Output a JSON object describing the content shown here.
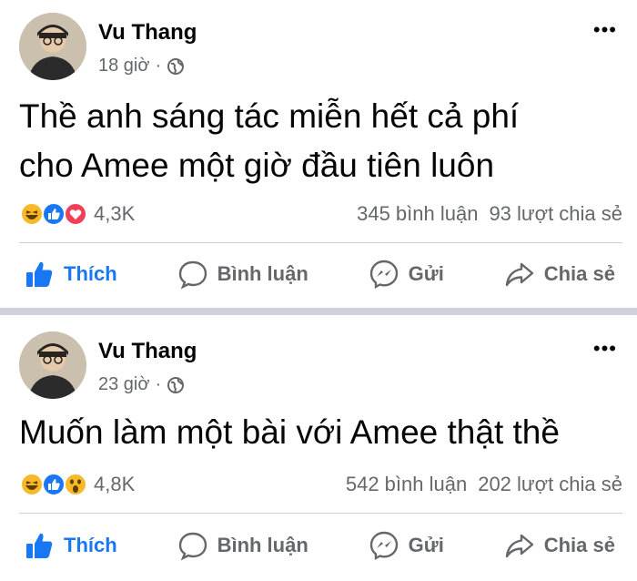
{
  "posts": [
    {
      "author": "Vu Thang",
      "time": "18 giờ",
      "separator": "·",
      "more": "•••",
      "text_line1": "Thề anh sáng tác miễn hết cả phí",
      "text_line2": "cho Amee một giờ đầu tiên luôn",
      "reactions": [
        "haha-icon",
        "like-icon",
        "love-icon"
      ],
      "reaction_count": "4,3K",
      "comments": "345 bình luận",
      "shares": "93 lượt chia sẻ",
      "actions": {
        "like": "Thích",
        "comment": "Bình luận",
        "send": "Gửi",
        "share": "Chia sẻ"
      }
    },
    {
      "author": "Vu Thang",
      "time": "23 giờ",
      "separator": "·",
      "more": "•••",
      "text_line1": "Muốn làm một bài với Amee thật thề",
      "reactions": [
        "haha-icon",
        "like-icon",
        "wow-icon"
      ],
      "reaction_count": "4,8K",
      "comments": "542 bình luận",
      "shares": "202 lượt chia sẻ",
      "actions": {
        "like": "Thích",
        "comment": "Bình luận",
        "send": "Gửi",
        "share": "Chia sẻ"
      }
    }
  ],
  "colors": {
    "accent": "#1877f2",
    "secondary_text": "#65676b",
    "divider": "#cfd3d9"
  }
}
